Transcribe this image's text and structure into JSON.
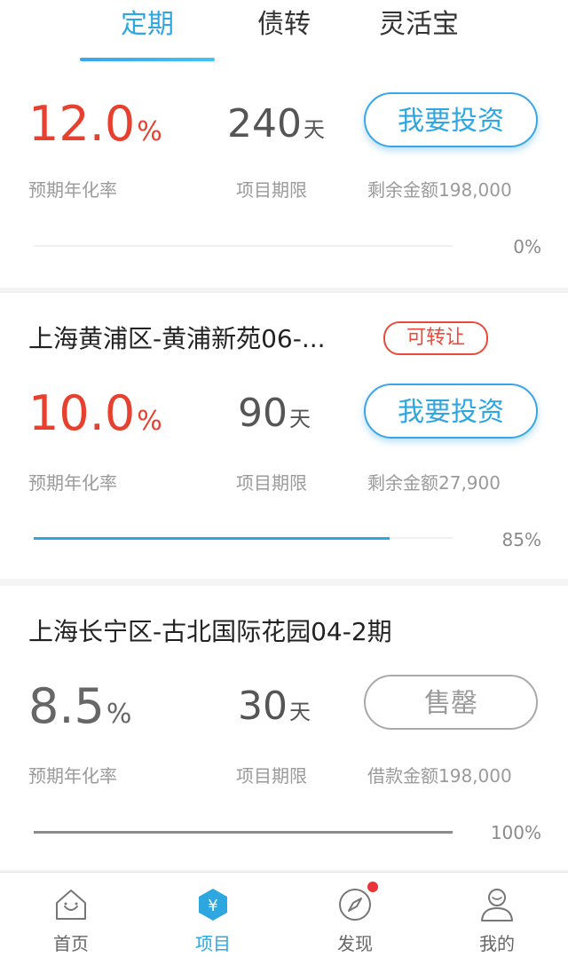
{
  "tabs": [
    {
      "label": "定期",
      "active": true
    },
    {
      "label": "债转",
      "active": false
    },
    {
      "label": "灵活宝",
      "active": false
    }
  ],
  "cards": [
    {
      "title": "",
      "badge": "",
      "rate": "12.0",
      "rate_suffix": "%",
      "rate_label": "预期年化率",
      "days": "240",
      "days_unit": "天",
      "days_label": "项目期限",
      "amount_label": "剩余金额198,000",
      "button": "我要投资",
      "progress": 0,
      "progress_text": "0%"
    },
    {
      "title": "上海黄浦区-黄浦新苑06-...",
      "badge": "可转让",
      "rate": "10.0",
      "rate_suffix": "%",
      "rate_label": "预期年化率",
      "days": "90",
      "days_unit": "天",
      "days_label": "项目期限",
      "amount_label": "剩余金额27,900",
      "button": "我要投资",
      "progress": 85,
      "progress_text": "85%"
    },
    {
      "title": "上海长宁区-古北国际花园04-2期",
      "badge": "",
      "rate": "8.5",
      "rate_suffix": "%",
      "rate_label": "预期年化率",
      "days": "30",
      "days_unit": "天",
      "days_label": "项目期限",
      "amount_label": "借款金额198,000",
      "button": "售罄",
      "progress": 100,
      "progress_text": "100%"
    }
  ],
  "bottom_nav": [
    {
      "label": "首页",
      "icon": "home-icon",
      "active": false
    },
    {
      "label": "项目",
      "icon": "project-icon",
      "active": true
    },
    {
      "label": "发现",
      "icon": "compass-icon",
      "active": false,
      "notification": true
    },
    {
      "label": "我的",
      "icon": "user-icon",
      "active": false
    }
  ],
  "colors": {
    "accent": "#2ea7e0",
    "rate_red": "#e8402f",
    "badge_red": "#e94a3a",
    "gray_text": "#9a9a9a"
  },
  "icons": {
    "project_symbol": "¥"
  }
}
